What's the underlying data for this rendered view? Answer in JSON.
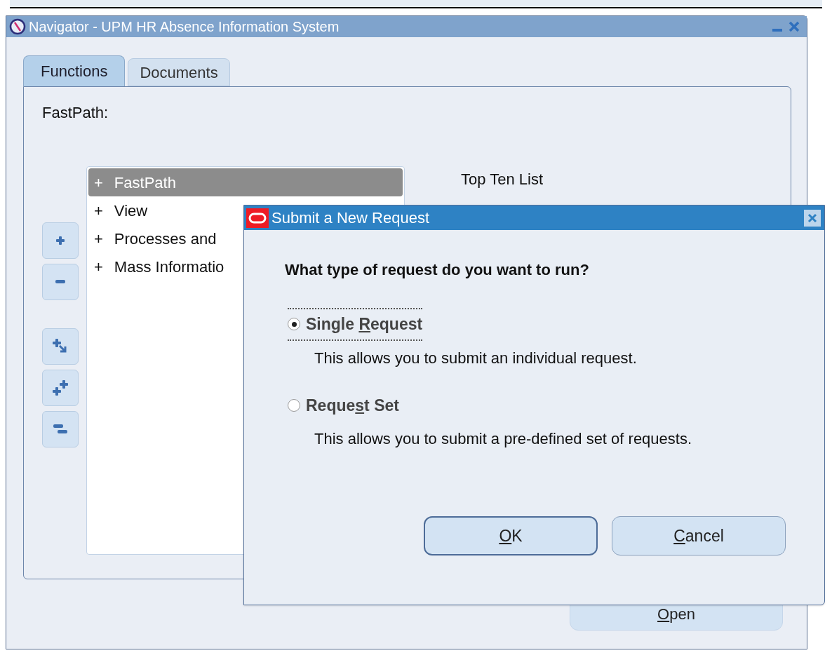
{
  "navigator": {
    "title": "Navigator - UPM HR Absence Information System",
    "tabs": [
      {
        "label": "Functions",
        "selected": true
      },
      {
        "label": "Documents",
        "selected": false
      }
    ],
    "fastpath_label": "FastPath:",
    "tree": [
      {
        "marker": "+",
        "label": "FastPath",
        "selected": true
      },
      {
        "marker": "+",
        "label": "View",
        "selected": false
      },
      {
        "marker": "+",
        "label": "Processes and",
        "selected": false
      },
      {
        "marker": "+",
        "label": "Mass Informatio",
        "selected": false
      }
    ],
    "top_ten_label": "Top Ten List",
    "open_button": {
      "key": "O",
      "post": "pen"
    }
  },
  "dialog": {
    "title": "Submit a New Request",
    "question": "What type of request do you want to run?",
    "options": [
      {
        "pre": "Single ",
        "key": "R",
        "post": "equest",
        "description": "This allows you to submit an individual request.",
        "selected": true
      },
      {
        "pre": "Reque",
        "key": "s",
        "post": "t Set",
        "description": "This allows you to submit a pre-defined set of requests.",
        "selected": false
      }
    ],
    "buttons": [
      {
        "key": "O",
        "post": "K",
        "default": true
      },
      {
        "key": "C",
        "post": "ancel",
        "default": false
      }
    ]
  }
}
